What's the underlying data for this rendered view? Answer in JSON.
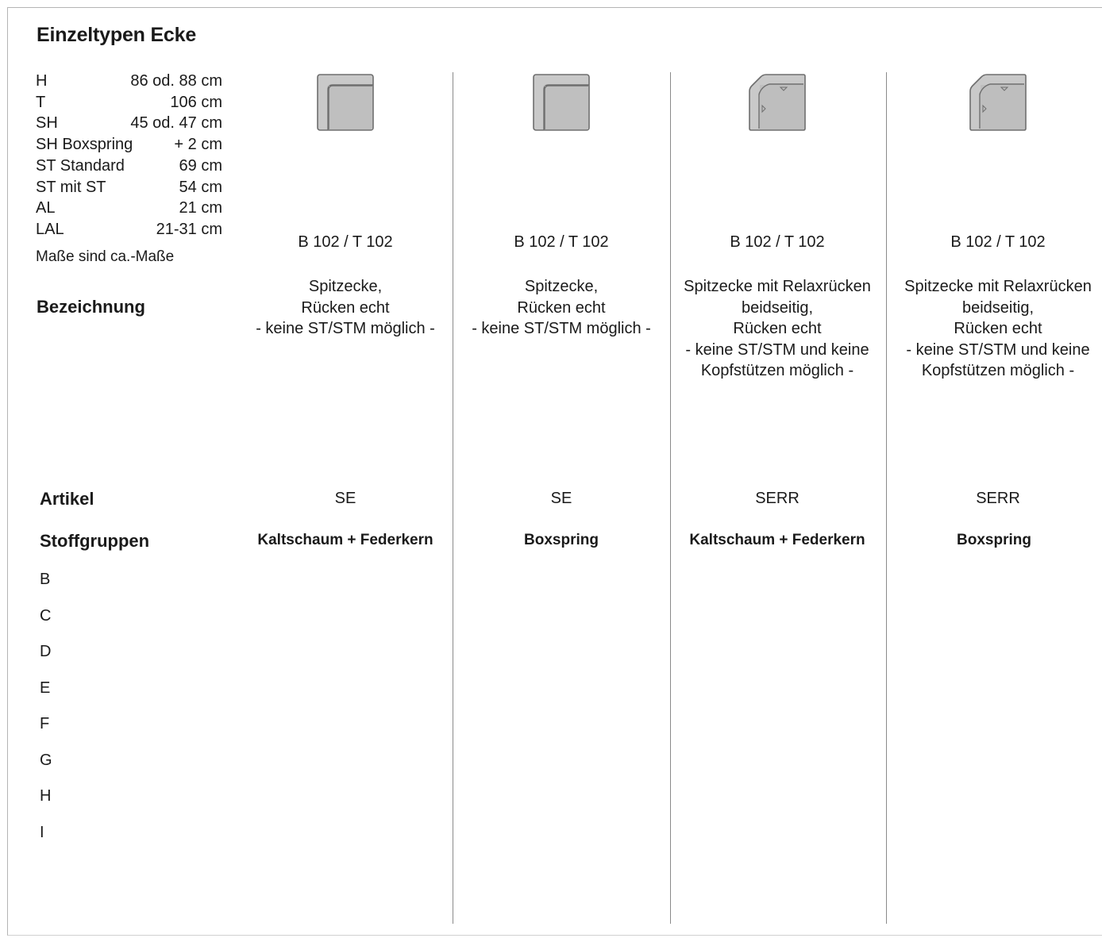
{
  "title": "Einzeltypen Ecke",
  "specs": [
    {
      "key": "H",
      "value": "86 od. 88 cm"
    },
    {
      "key": "T",
      "value": "106 cm"
    },
    {
      "key": "SH",
      "value": "45 od. 47 cm"
    },
    {
      "key": "SH Boxspring",
      "value": "+ 2 cm"
    },
    {
      "key": "ST Standard",
      "value": "69 cm"
    },
    {
      "key": "ST mit ST",
      "value": "54 cm"
    },
    {
      "key": "AL",
      "value": "21 cm"
    },
    {
      "key": "LAL",
      "value": "21-31 cm"
    }
  ],
  "note": "Maße sind ca.-Maße",
  "labels": {
    "bezeichnung": "Bezeichnung",
    "artikel": "Artikel",
    "stoffgruppen": "Stoffgruppen"
  },
  "fabric_groups": [
    "B",
    "C",
    "D",
    "E",
    "F",
    "G",
    "H",
    "I"
  ],
  "columns": [
    {
      "icon": "spitzecke-icon",
      "dimensions": "B 102 / T 102",
      "description": [
        "Spitzecke,",
        "Rücken echt",
        "- keine ST/STM möglich -"
      ],
      "article": "SE",
      "foam": "Kaltschaum + Federkern"
    },
    {
      "icon": "spitzecke-icon",
      "dimensions": "B 102 / T 102",
      "description": [
        "Spitzecke,",
        "Rücken echt",
        "- keine ST/STM möglich -"
      ],
      "article": "SE",
      "foam": "Boxspring"
    },
    {
      "icon": "spitzecke-relax-icon",
      "dimensions": "B 102 / T 102",
      "description": [
        "Spitzecke mit Relaxrücken",
        "beidseitig,",
        "Rücken echt",
        "- keine ST/STM und keine",
        "Kopfstützen möglich -"
      ],
      "article": "SERR",
      "foam": "Kaltschaum + Federkern"
    },
    {
      "icon": "spitzecke-relax-icon",
      "dimensions": "B 102 / T 102",
      "description": [
        "Spitzecke mit Relaxrücken",
        "beidseitig,",
        "Rücken echt",
        "- keine ST/STM und keine",
        "Kopfstützen möglich -"
      ],
      "article": "SERR",
      "foam": "Boxspring"
    }
  ]
}
